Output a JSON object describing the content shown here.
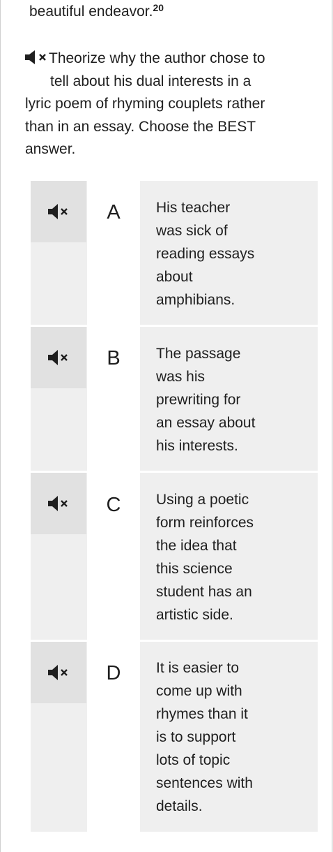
{
  "previous_line": {
    "text": "beautiful endeavor.",
    "footnote": "20"
  },
  "question": {
    "audio_icon": "speaker-muted-icon",
    "lines": [
      "Theorize why the author chose to",
      "tell about his dual interests in a",
      "lyric poem of rhyming couplets rather",
      "than in an essay. Choose the BEST",
      "answer."
    ]
  },
  "choices": [
    {
      "letter": "A",
      "audio_icon": "speaker-muted-icon",
      "lines": [
        "His teacher",
        "was sick of",
        "reading essays",
        "about",
        "amphibians."
      ]
    },
    {
      "letter": "B",
      "audio_icon": "speaker-muted-icon",
      "lines": [
        "The passage",
        "was his",
        "prewriting for",
        "an essay about",
        "his interests."
      ]
    },
    {
      "letter": "C",
      "audio_icon": "speaker-muted-icon",
      "lines": [
        "Using a poetic",
        "form reinforces",
        "the idea that",
        "this science",
        "student has an",
        "artistic side."
      ]
    },
    {
      "letter": "D",
      "audio_icon": "speaker-muted-icon",
      "lines": [
        "It is easier to",
        "come up with",
        "rhymes than it",
        "is to support",
        "lots of topic",
        "sentences with",
        "details."
      ]
    }
  ],
  "colors": {
    "text": "#1f1f1f",
    "choice_background": "#efefef",
    "audio_cell_background": "#e1e1e1",
    "letter_cell_background": "#ffffff"
  }
}
